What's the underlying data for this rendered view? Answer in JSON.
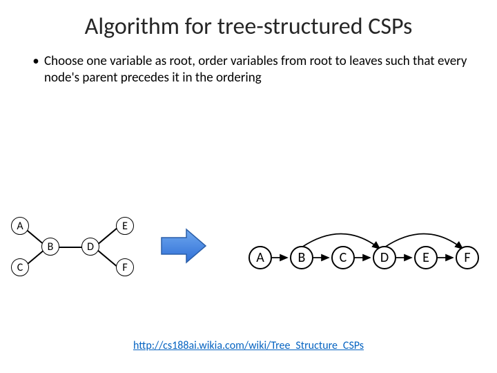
{
  "title": "Algorithm for tree-structured CSPs",
  "bullet": "Choose one variable as root, order variables from root to leaves such that every node's parent precedes it in the ordering",
  "tree_nodes": {
    "A": "A",
    "B": "B",
    "C": "C",
    "D": "D",
    "E": "E",
    "F": "F"
  },
  "linear_nodes": [
    "A",
    "B",
    "C",
    "D",
    "E",
    "F"
  ],
  "link": {
    "text": "http://cs188ai.wikia.com/wiki/Tree_Structure_CSPs",
    "href": "http://cs188ai.wikia.com/wiki/Tree_Structure_CSPs"
  }
}
